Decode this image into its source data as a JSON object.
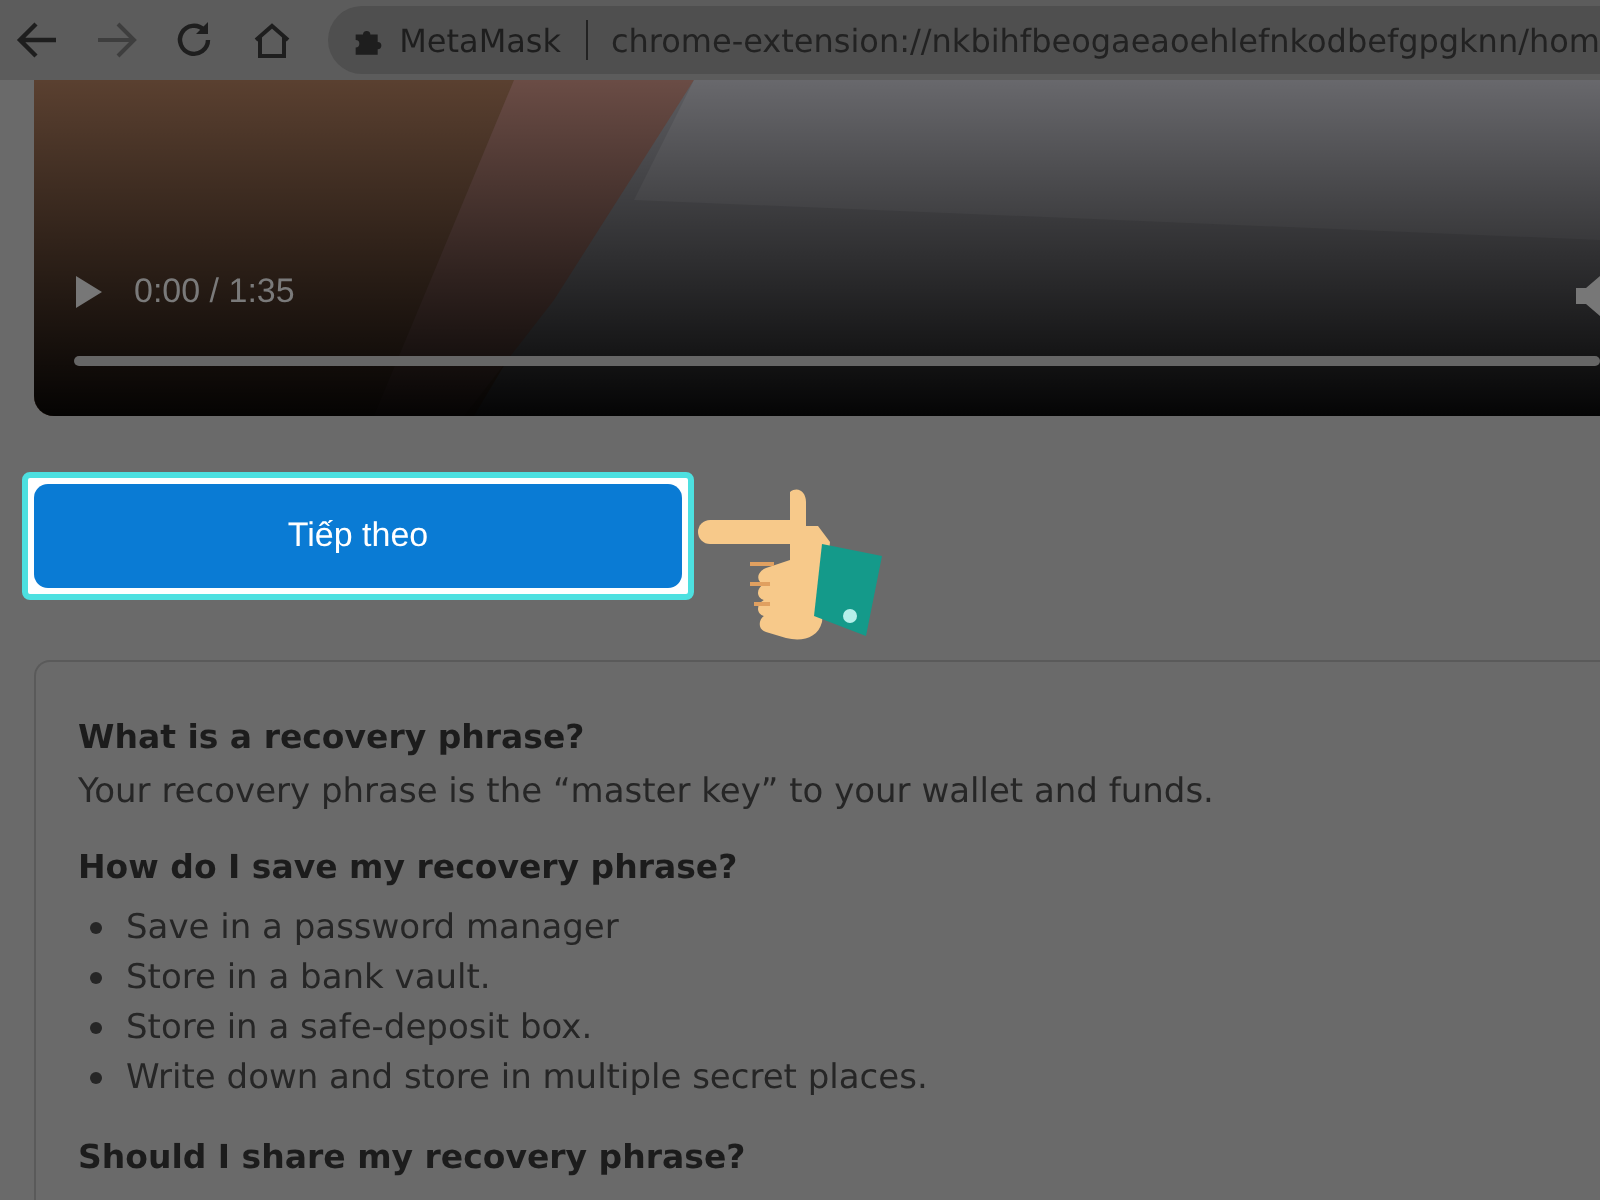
{
  "browser": {
    "site_name": "MetaMask",
    "url": "chrome-extension://nkbihfbeogaeaoehlefnkodbefgpgknn/hom"
  },
  "video": {
    "kind": "picture",
    "time": "0:00 / 1:35"
  },
  "next_button": {
    "label": "Tiếp theo",
    "highlighted": true
  },
  "info": [
    {
      "kind": "paragraph",
      "heading": "What is a recovery phrase?",
      "text": "Your recovery phrase is the “master key” to your wallet and funds."
    },
    {
      "kind": "list",
      "heading": "How do I save my recovery phrase?",
      "items": [
        "Save in a password manager",
        "Store in a bank vault.",
        "Store in a safe-deposit box.",
        "Write down and store in multiple secret places."
      ]
    },
    {
      "kind": "heading",
      "heading": "Should I share my recovery phrase?"
    }
  ]
}
